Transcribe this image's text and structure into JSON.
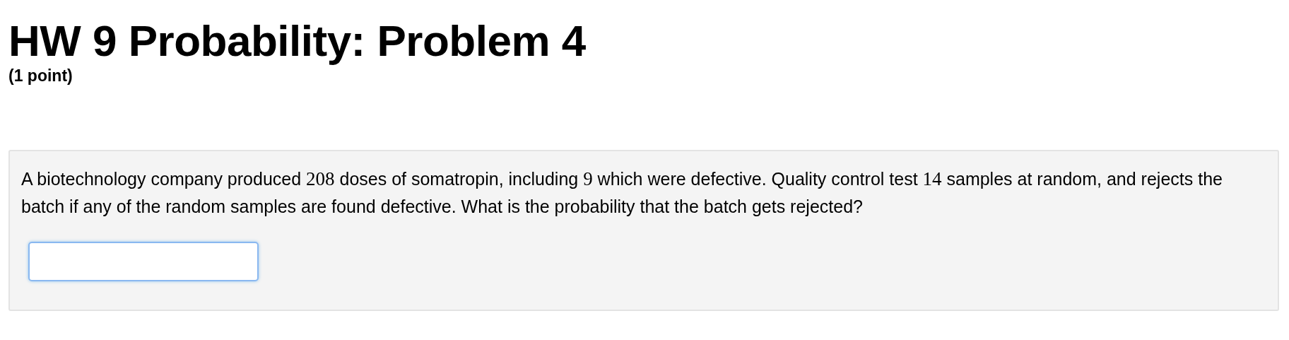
{
  "title": "HW 9 Probability: Problem 4",
  "points": "(1 point)",
  "problem": {
    "parts": [
      {
        "kind": "text",
        "text": "A biotechnology company produced "
      },
      {
        "kind": "math",
        "text": "208"
      },
      {
        "kind": "text",
        "text": " doses of somatropin, including "
      },
      {
        "kind": "math",
        "text": "9"
      },
      {
        "kind": "text",
        "text": " which were defective. Quality control test "
      },
      {
        "kind": "math",
        "text": "14"
      },
      {
        "kind": "text",
        "text": " samples at random, and rejects the batch if any of the random samples are found defective. What is the probability that the batch gets rejected?"
      }
    ],
    "answer": {
      "focused": true
    }
  }
}
